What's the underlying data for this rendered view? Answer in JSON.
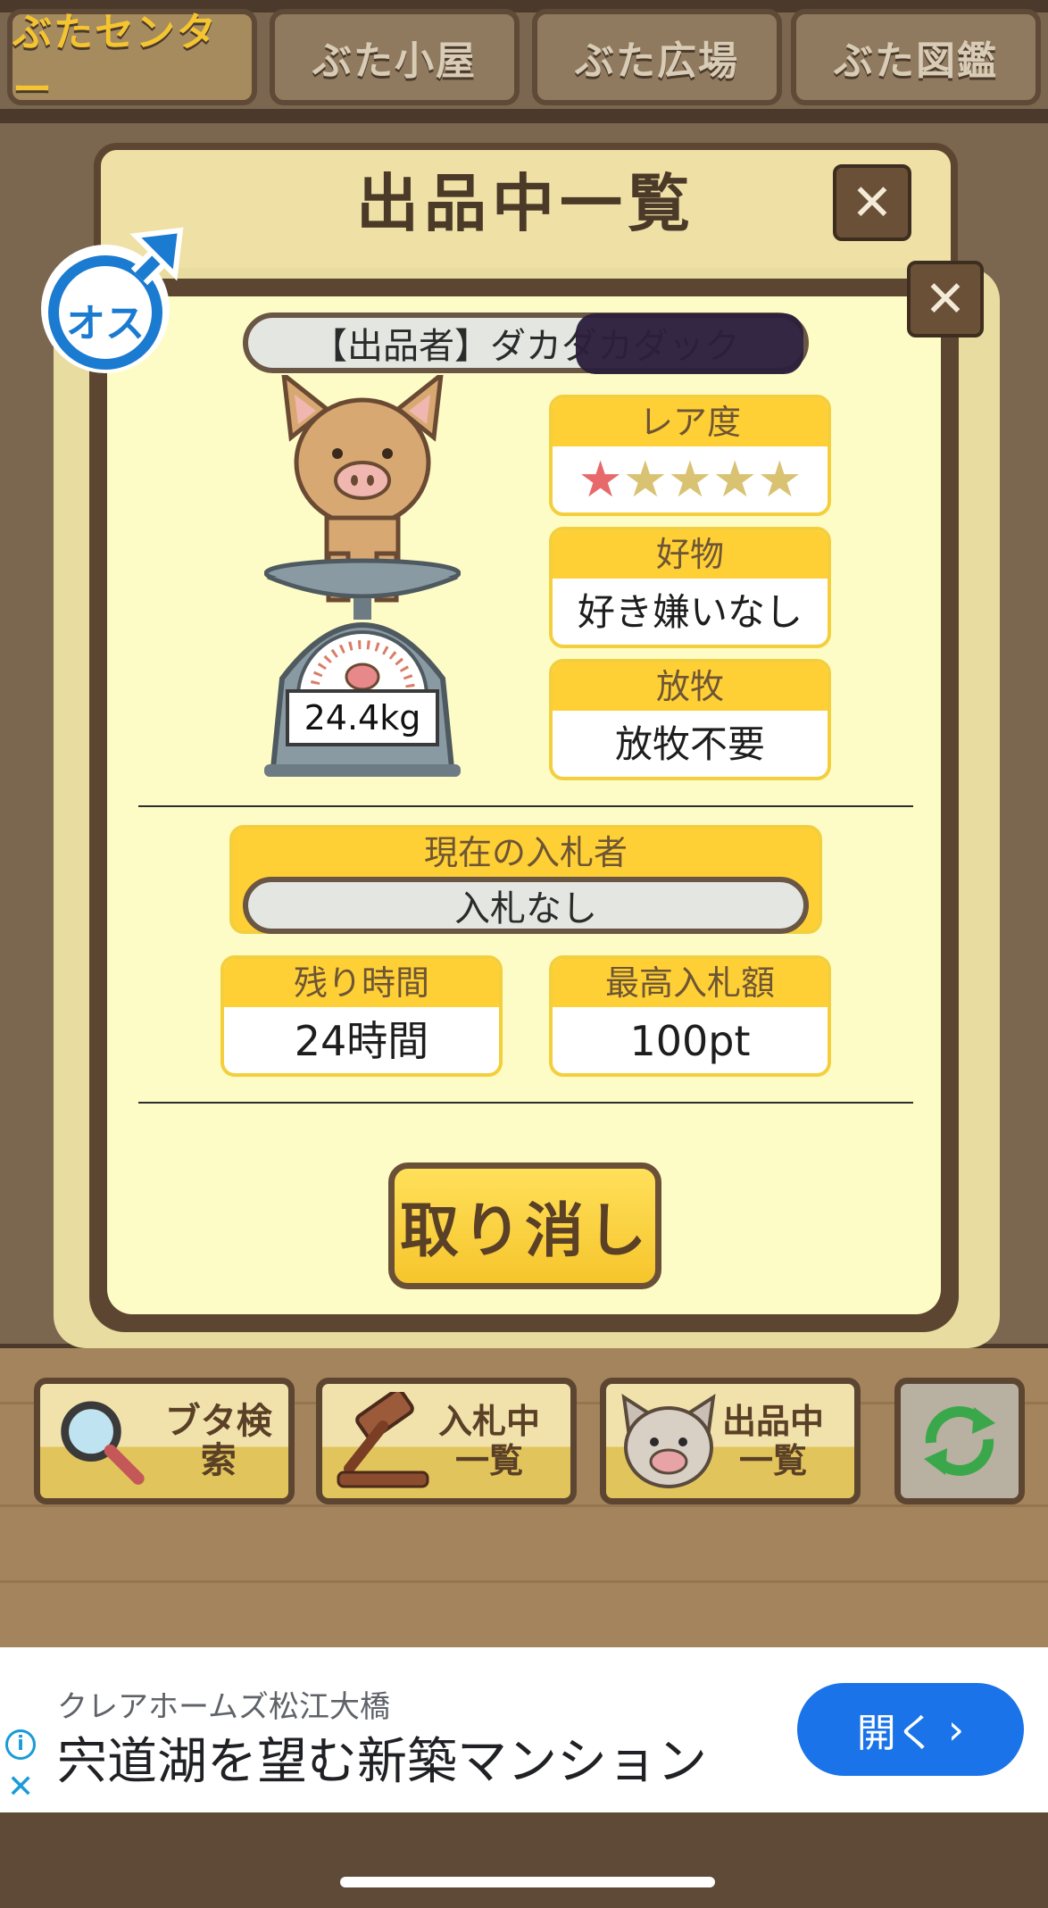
{
  "nav": {
    "tabs": [
      {
        "label": "ぶたセンター",
        "active": true
      },
      {
        "label": "ぶた小屋",
        "active": false
      },
      {
        "label": "ぶた広場",
        "active": false
      },
      {
        "label": "ぶた図鑑",
        "active": false
      }
    ]
  },
  "outer_window": {
    "title": "出品中一覧",
    "close_symbol": "✕"
  },
  "detail": {
    "close_symbol": "✕",
    "gender_badge": "オス",
    "seller_label": "【出品者】ダカダカダック",
    "weight": "24.4kg",
    "rarity": {
      "header": "レア度",
      "stars": "★★★★★",
      "filled": 1,
      "total": 5
    },
    "favorite": {
      "header": "好物",
      "value": "好き嫌いなし"
    },
    "grazing": {
      "header": "放牧",
      "value": "放牧不要"
    },
    "current_bidder": {
      "header": "現在の入札者",
      "value": "入札なし"
    },
    "time_left": {
      "header": "残り時間",
      "value": "24時間"
    },
    "highest_bid": {
      "header": "最高入札額",
      "value": "100pt"
    },
    "cancel_label": "取り消し"
  },
  "toolbar": {
    "search": {
      "label": "ブタ検索",
      "icon": "magnifier-icon"
    },
    "bidding": {
      "line1": "入札中",
      "line2": "一覧",
      "icon": "gavel-icon"
    },
    "listing": {
      "line1": "出品中",
      "line2": "一覧",
      "icon": "pig-face-icon"
    },
    "refresh": {
      "icon": "refresh-icon"
    }
  },
  "ad": {
    "advertiser": "クレアホームズ松江大橋",
    "headline": "宍道湖を望む新築マンション",
    "open_label": "開く",
    "colors": {
      "button": "#1a73e8"
    }
  },
  "colors": {
    "panel_bg": "#fefcc6",
    "header_yellow": "#ffd035",
    "frame_brown": "#5c4631",
    "star_filled": "#e7696c",
    "star_empty": "#d9c272"
  }
}
